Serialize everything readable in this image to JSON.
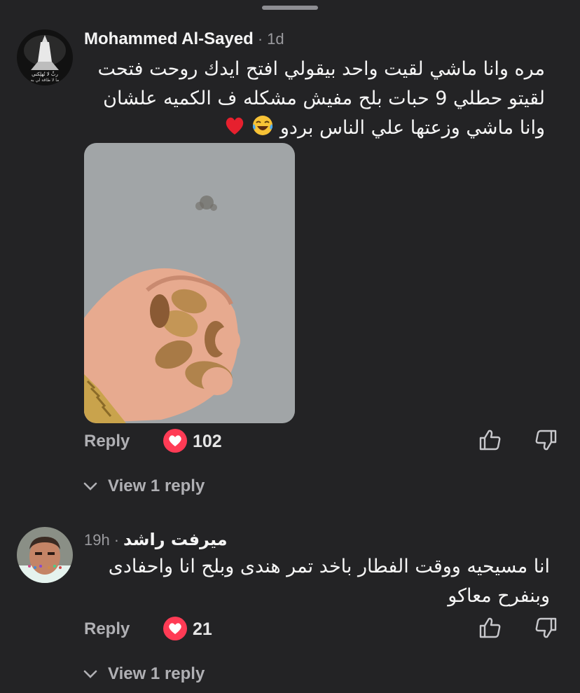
{
  "sheet": {
    "handle": "drag-handle"
  },
  "comments": [
    {
      "author": "Mohammed Al-Sayed",
      "separator": "·",
      "time": "1d",
      "avatar_text": [
        "ربِّ لا تُهلِكني",
        "ما لا طاقة لي به"
      ],
      "lines": [
        "مره وانا ماشي لقيت واحد بيقولي افتح ايدك روحت فتحت",
        "لقيتو حطلي 9 حبات بلح مفيش مشكله ف الكميه علشان",
        "وانا ماشي وزعتها علي الناس بردو"
      ],
      "emojis": [
        "face-with-tears-of-joy",
        "red-heart"
      ],
      "has_photo": true,
      "reply_label": "Reply",
      "likes": "102",
      "view_replies": "View 1 reply"
    },
    {
      "author": "ميرفت  راشد",
      "separator": "·",
      "time": "19h",
      "lines": [
        "انا مسيحيه ووقت الفطار باخد تمر هندى وبلح انا واحفادى",
        "وبنفرح معاكو"
      ],
      "reply_label": "Reply",
      "likes": "21",
      "view_replies": "View 1 reply"
    }
  ],
  "icons": {
    "like": "thumbs-up-icon",
    "dislike": "thumbs-down-icon",
    "heart": "heart-icon",
    "chevron": "chevron-down-icon"
  },
  "colors": {
    "background": "#232325",
    "heart_badge": "#ff3b55",
    "secondary_text": "#9a9a9e"
  }
}
